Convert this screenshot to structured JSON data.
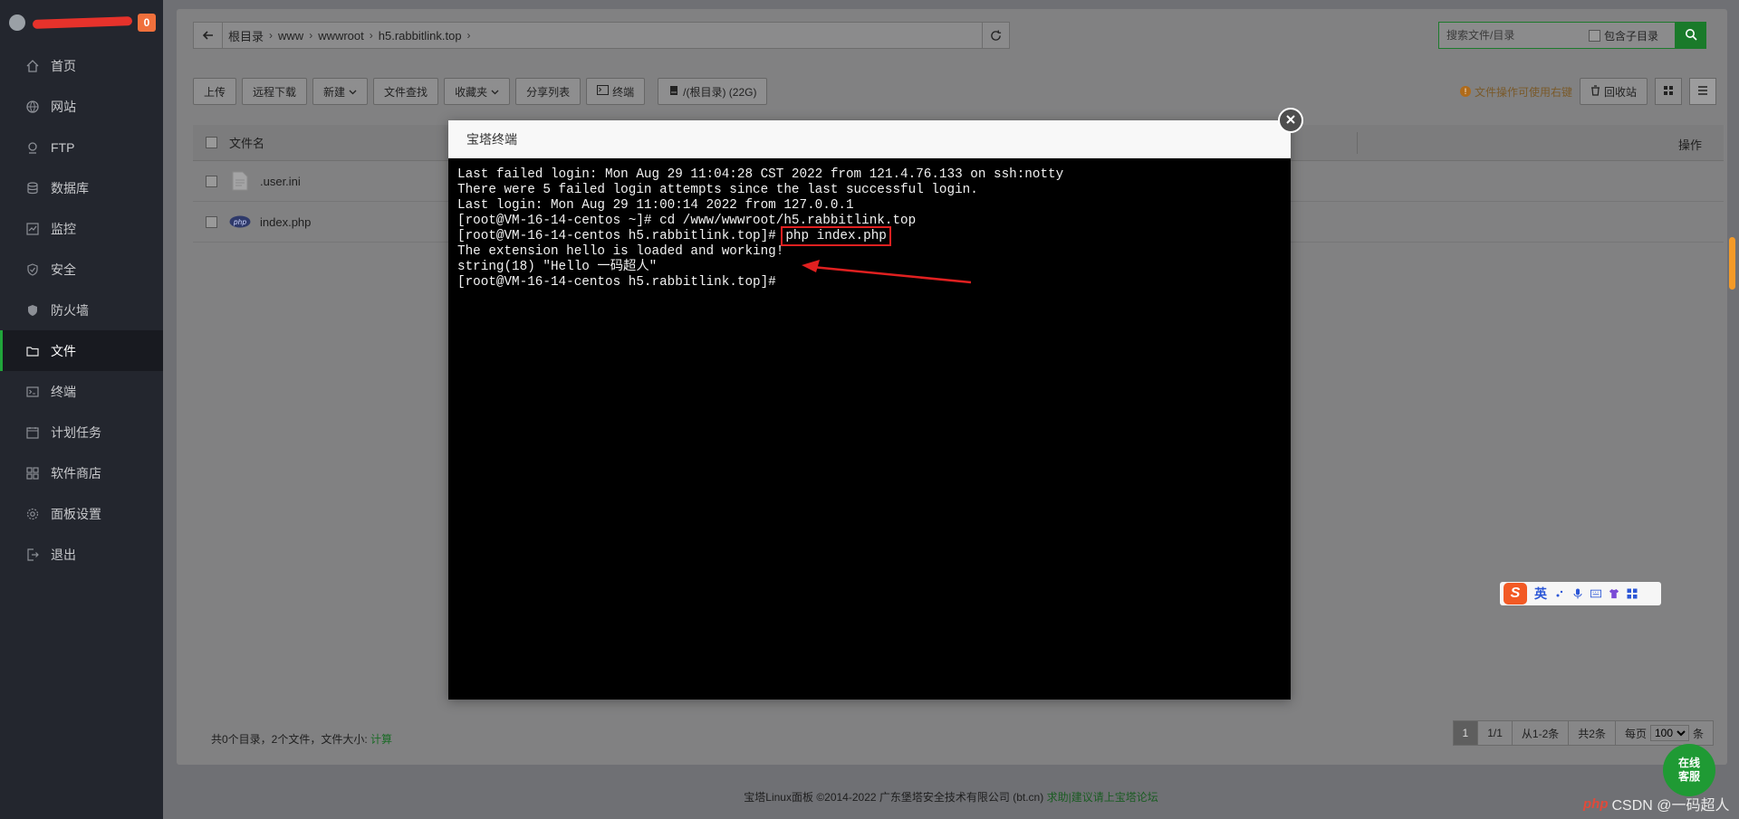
{
  "sidebar": {
    "badge": "0",
    "items": [
      {
        "label": "首页",
        "icon": "home-icon"
      },
      {
        "label": "网站",
        "icon": "globe-icon"
      },
      {
        "label": "FTP",
        "icon": "ftp-icon"
      },
      {
        "label": "数据库",
        "icon": "database-icon"
      },
      {
        "label": "监控",
        "icon": "monitor-icon"
      },
      {
        "label": "安全",
        "icon": "shield-check-icon"
      },
      {
        "label": "防火墙",
        "icon": "firewall-shield-icon"
      },
      {
        "label": "文件",
        "icon": "folder-icon",
        "active": true
      },
      {
        "label": "终端",
        "icon": "terminal-icon"
      },
      {
        "label": "计划任务",
        "icon": "calendar-icon"
      },
      {
        "label": "软件商店",
        "icon": "apps-grid-icon"
      },
      {
        "label": "面板设置",
        "icon": "settings-gear-icon"
      },
      {
        "label": "退出",
        "icon": "logout-icon"
      }
    ]
  },
  "path": {
    "crumbs": [
      "根目录",
      "www",
      "wwwroot",
      "h5.rabbitlink.top"
    ]
  },
  "search": {
    "placeholder": "搜索文件/目录",
    "include_sub": "包含子目录"
  },
  "toolbar": {
    "upload": "上传",
    "remote_download": "远程下载",
    "new": "新建",
    "file_search": "文件查找",
    "favorites": "收藏夹",
    "share_list": "分享列表",
    "terminal": "终端",
    "disk": "/(根目录) (22G)"
  },
  "right_tools": {
    "hint": "文件操作可使用右键",
    "recycle": "回收站"
  },
  "table": {
    "col_name": "文件名",
    "col_op": "操作",
    "rows": [
      {
        "name": ".user.ini",
        "icon": "file-icon"
      },
      {
        "name": "index.php",
        "icon": "php-icon"
      }
    ]
  },
  "footer": {
    "summary": "共0个目录，2个文件，文件大小:",
    "calc_link": "计算",
    "pager": {
      "current": "1",
      "pages": "1/1",
      "range": "从1-2条",
      "total": "共2条",
      "per_page_label": "每页",
      "per_page_value": "100",
      "per_page_suffix": "条"
    },
    "copyright": "宝塔Linux面板 ©2014-2022 广东堡塔安全技术有限公司 (bt.cn)",
    "help_link": "求助|建议请上宝塔论坛"
  },
  "modal": {
    "title": "宝塔终端",
    "terminal_lines": [
      "Last failed login: Mon Aug 29 11:04:28 CST 2022 from 121.4.76.133 on ssh:notty",
      "There were 5 failed login attempts since the last successful login.",
      "Last login: Mon Aug 29 11:00:14 2022 from 127.0.0.1",
      "[root@VM-16-14-centos ~]# cd /www/wwwroot/h5.rabbitlink.top",
      "[root@VM-16-14-centos h5.rabbitlink.top]# ",
      "The extension hello is loaded and working!",
      "string(18) \"Hello 一码超人\"",
      "[root@VM-16-14-centos h5.rabbitlink.top]# "
    ],
    "highlighted_command": "php index.php"
  },
  "service_button": {
    "line1": "在线",
    "line2": "客服"
  },
  "ime_bar": {
    "mode": "英"
  },
  "watermark": {
    "brand": "php",
    "text": "CSDN @一码超人"
  },
  "colors": {
    "accent_green": "#20a53a",
    "annotation_red": "#e02020",
    "sidebar_bg": "#23262e",
    "terminal_bg": "#000000"
  }
}
